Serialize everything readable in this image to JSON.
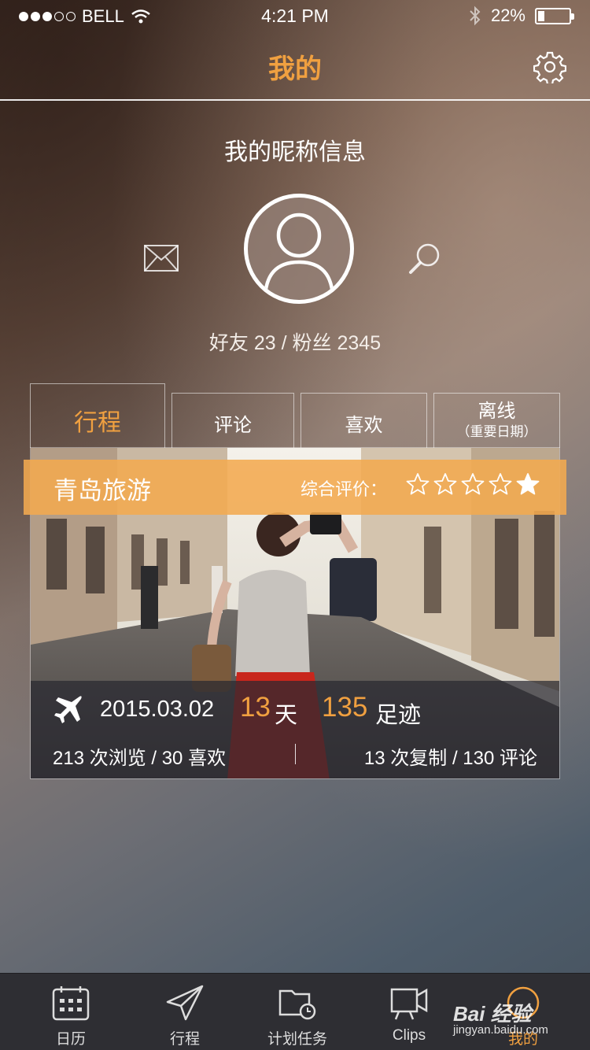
{
  "status_bar": {
    "carrier": "BELL",
    "time": "4:21 PM",
    "battery_percent": "22%",
    "battery_level": 0.22,
    "signal_dots_filled": 3,
    "signal_dots_total": 5,
    "icons": [
      "wifi-icon",
      "bluetooth-icon",
      "battery-icon"
    ]
  },
  "header": {
    "title": "我的",
    "settings_icon": "gear-icon"
  },
  "profile": {
    "nickname": "我的昵称信息",
    "friends_label": "好友",
    "friends_count": "23",
    "separator": "/",
    "fans_label": "粉丝",
    "fans_count": "2345",
    "left_icon": "mail-icon",
    "right_icon": "search-icon"
  },
  "tabs": [
    {
      "label": "行程",
      "active": true
    },
    {
      "label": "评论"
    },
    {
      "label": "喜欢"
    },
    {
      "label": "离线",
      "sub": "（重要日期）"
    }
  ],
  "trip_card": {
    "title": "青岛旅游",
    "rating_label": "综合评价：",
    "rating": 1,
    "rating_max": 5,
    "date": "2015.03.02",
    "days": "13",
    "days_unit": "天",
    "footprints": "135",
    "footprints_unit": "足迹",
    "stats_left": "213 次浏览 / 30 喜欢",
    "stats_right": "13 次复制 / 130 评论"
  },
  "tab_bar": [
    {
      "label": "日历",
      "icon": "calendar-icon"
    },
    {
      "label": "行程",
      "icon": "paper-plane-icon"
    },
    {
      "label": "计划任务",
      "icon": "folder-clock-icon"
    },
    {
      "label": "Clips",
      "icon": "video-camera-icon"
    },
    {
      "label": "我的",
      "icon": "profile-icon",
      "active": true
    }
  ],
  "watermark": {
    "brand": "Bai 经验",
    "url": "jingyan.baidu.com"
  },
  "colors": {
    "accent": "#f0a040",
    "banner": "#f2aa50",
    "tabbar_bg": "#2e2e33"
  }
}
